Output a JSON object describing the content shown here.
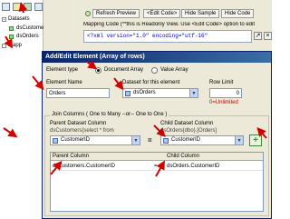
{
  "toolbar": {
    "refresh_label": "Refresh Preview",
    "edit_code_label": "<Edit Code>",
    "hide_sample_label": "Hide Sample",
    "hide_code_label": "Hide Code"
  },
  "tree": {
    "datasets_label": "Datasets",
    "ds_customers_label": "dsCustomers (Rows)",
    "ds_orders_label": "dsOrders",
    "mapping_label": "Mapp"
  },
  "code_panel": {
    "header": "Mapping Code (**this is Readonly View. Use <Edit Code> option to edit",
    "xml_line": "<?xml version=\"1.0\" encoding=\"utf-16\""
  },
  "dialog": {
    "title": "Add/Edit Element (Array of rows)",
    "element_type_label": "Element type",
    "option_document_array": "Document Array",
    "option_value_array": "Value Array",
    "element_name_label": "Element Name",
    "element_name_value": "Orders",
    "dataset_label": "Dataset for this element",
    "dataset_value": "dsOrders",
    "row_limit_label": "Row Limit",
    "row_limit_value": "0",
    "row_limit_hint": "0=Unlimited",
    "join_group_label": "Join Columns  ( One to Many  --or--  One to One )",
    "parent_dataset_label": "Parent Dataset Column",
    "parent_dataset_desc": "dsCustomers{select * from",
    "parent_column_value": "CustomerID",
    "equals": "=",
    "child_dataset_label": "Child Dataset Column",
    "child_dataset_desc": "dsOrders{dbo}.[Orders]",
    "child_column_value": "CustomerID",
    "add_button": "+",
    "grid": {
      "col_parent": "Parent Column",
      "col_child": "Child Column",
      "rows": [
        {
          "parent": "dsCustomers.CustomerID",
          "eq": "=",
          "child": "dsOrders.CustomerID"
        }
      ]
    }
  },
  "colors": {
    "title_bar": "#0a246a",
    "annotation_arrow": "#d40000",
    "hint_text": "#cc0000",
    "add_button": "#2e9b2e"
  }
}
